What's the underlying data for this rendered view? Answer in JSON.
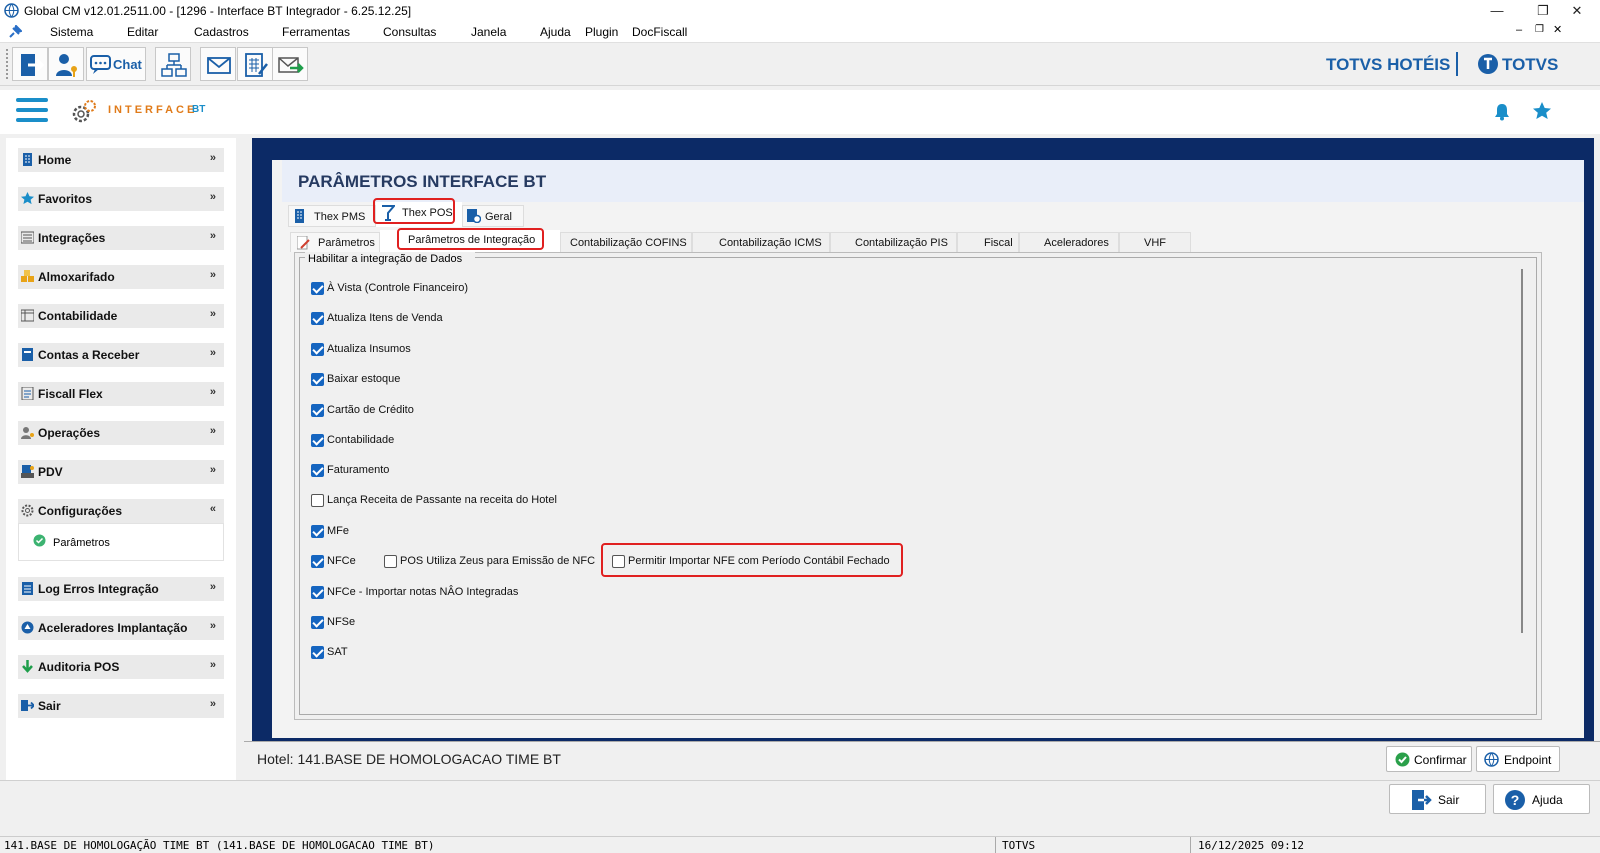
{
  "window": {
    "title": "Global CM v12.01.2511.00 - [1296 - Interface BT Integrador - 6.25.12.25]"
  },
  "menu": [
    "Sistema",
    "Editar",
    "Cadastros",
    "Ferramentas",
    "Consultas",
    "Janela",
    "Ajuda",
    "Plugin",
    "DocFiscall"
  ],
  "toolbar": {
    "chat_label": "Chat"
  },
  "brand": {
    "left": "TOTVS HOTÉIS",
    "right": "TOTVS"
  },
  "header": {
    "app": "INTERFACE",
    "app_suffix": "BT"
  },
  "sidebar": {
    "items": [
      {
        "label": "Home"
      },
      {
        "label": "Favoritos"
      },
      {
        "label": "Integrações"
      },
      {
        "label": "Almoxarifado"
      },
      {
        "label": "Contabilidade"
      },
      {
        "label": "Contas a Receber"
      },
      {
        "label": "Fiscall Flex"
      },
      {
        "label": "Operações"
      },
      {
        "label": "PDV"
      },
      {
        "label": "Configurações"
      },
      {
        "label": "Log Erros Integração"
      },
      {
        "label": "Aceleradores Implantação"
      },
      {
        "label": "Auditoria POS"
      },
      {
        "label": "Sair"
      }
    ],
    "sub_item": "Parâmetros"
  },
  "panel": {
    "title": "PARÂMETROS INTERFACE BT",
    "tabs": [
      "Thex PMS",
      "Thex POS",
      "Geral"
    ],
    "subtabs": [
      "Parâmetros",
      "Parâmetros de Integração",
      "Contabilização COFINS",
      "Contabilização ICMS",
      "Contabilização PIS",
      "Fiscal",
      "Aceleradores",
      "VHF"
    ],
    "group_title": "Habilitar a integração de Dados",
    "checks": [
      {
        "label": "À Vista (Controle Financeiro)",
        "checked": true
      },
      {
        "label": "Atualiza Itens de Venda",
        "checked": true
      },
      {
        "label": "Atualiza Insumos",
        "checked": true
      },
      {
        "label": "Baixar estoque",
        "checked": true
      },
      {
        "label": "Cartão de Crédito",
        "checked": true
      },
      {
        "label": "Contabilidade",
        "checked": true
      },
      {
        "label": "Faturamento",
        "checked": true
      },
      {
        "label": "Lança Receita de Passante na receita do Hotel",
        "checked": false
      },
      {
        "label": "MFe",
        "checked": true
      },
      {
        "label": "NFCe",
        "checked": true
      },
      {
        "label": "NFCe - Importar notas NÂO Integradas",
        "checked": true
      },
      {
        "label": "NFSe",
        "checked": true
      },
      {
        "label": "SAT",
        "checked": true
      }
    ],
    "check_zeus": {
      "label": "POS Utiliza Zeus para Emissão de NFC",
      "checked": false
    },
    "check_nfe": {
      "label": "Permitir Importar NFE com Período Contábil Fechado",
      "checked": false
    }
  },
  "hotel": "Hotel: 141.BASE DE HOMOLOGACAO TIME BT",
  "buttons": {
    "confirm": "Confirmar",
    "endpoint": "Endpoint",
    "exit": "Sair",
    "help": "Ajuda"
  },
  "status": {
    "base": "141.BASE DE HOMOLOGAÇÃO TIME BT  (141.BASE DE HOMOLOGACAO TIME BT)",
    "company": "TOTVS",
    "datetime": "16/12/2025 09:12"
  },
  "colors": {
    "frame": "#0c2a66",
    "accent": "#1565c0",
    "highlight": "#e02020",
    "brand": "#1a5fa8",
    "orange": "#e07b1a"
  }
}
